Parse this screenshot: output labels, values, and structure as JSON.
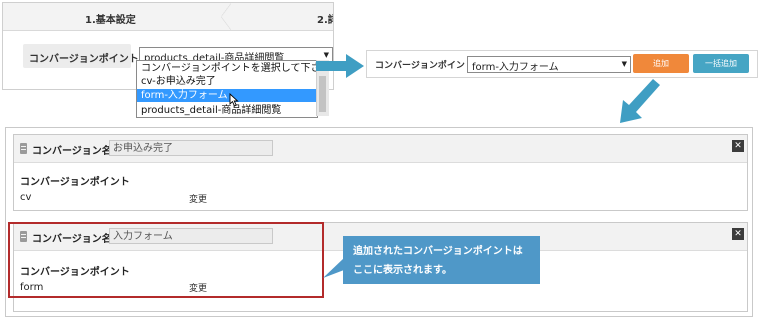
{
  "top_left": {
    "steps": [
      "1.基本設定",
      "2.詳"
    ],
    "conversion_point_label": "コンバージョンポイント",
    "select_value": "products_detail-商品詳細閲覧",
    "dropdown_options": [
      "コンバージョンポイントを選択して下さい",
      "cv-お申込み完了",
      "form-入力フォーム",
      "products_detail-商品詳細閲覧"
    ],
    "selected_option_index": 2
  },
  "top_right": {
    "conversion_point_label": "コンバージョンポイント",
    "select_value": "form-入力フォーム",
    "add_button": "追加",
    "bulk_add_button": "一括追加"
  },
  "cards": [
    {
      "name_label": "コンバージョン名",
      "name_value": "お申込み完了",
      "cp_title": "コンバージョンポイント",
      "cp_value": "cv",
      "change_link": "変更",
      "close": "✕"
    },
    {
      "name_label": "コンバージョン名",
      "name_value": "入力フォーム",
      "cp_title": "コンバージョンポイント",
      "cp_value": "form",
      "change_link": "変更",
      "close": "✕"
    }
  ],
  "callout": {
    "line1": "追加されたコンバージョンポイントは",
    "line2": "ここに表示されます。"
  },
  "colors": {
    "accent_orange": "#f0883a",
    "accent_blue": "#46a5c4",
    "arrow_teal": "#3f9ec3",
    "selected_option": "#3399ff",
    "highlight_red": "#b32b2b",
    "callout_blue": "#4f98c8"
  }
}
